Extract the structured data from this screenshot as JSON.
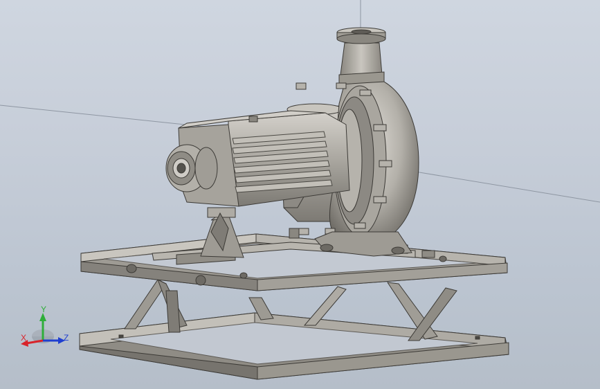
{
  "viewport": {
    "background_top": "#cfd6e0",
    "background_bottom": "#b5bec9"
  },
  "model": {
    "description_icon": "centrifugal-pump-on-skid-icon",
    "metal_color": "#a9a69f",
    "metal_dark": "#6f6c66",
    "metal_light": "#d7d4ce"
  },
  "triad": {
    "x_label": "X",
    "y_label": "Y",
    "z_label": "Z",
    "x_color": "#d8232a",
    "y_color": "#2fae3a",
    "z_color": "#1f3fd0"
  }
}
